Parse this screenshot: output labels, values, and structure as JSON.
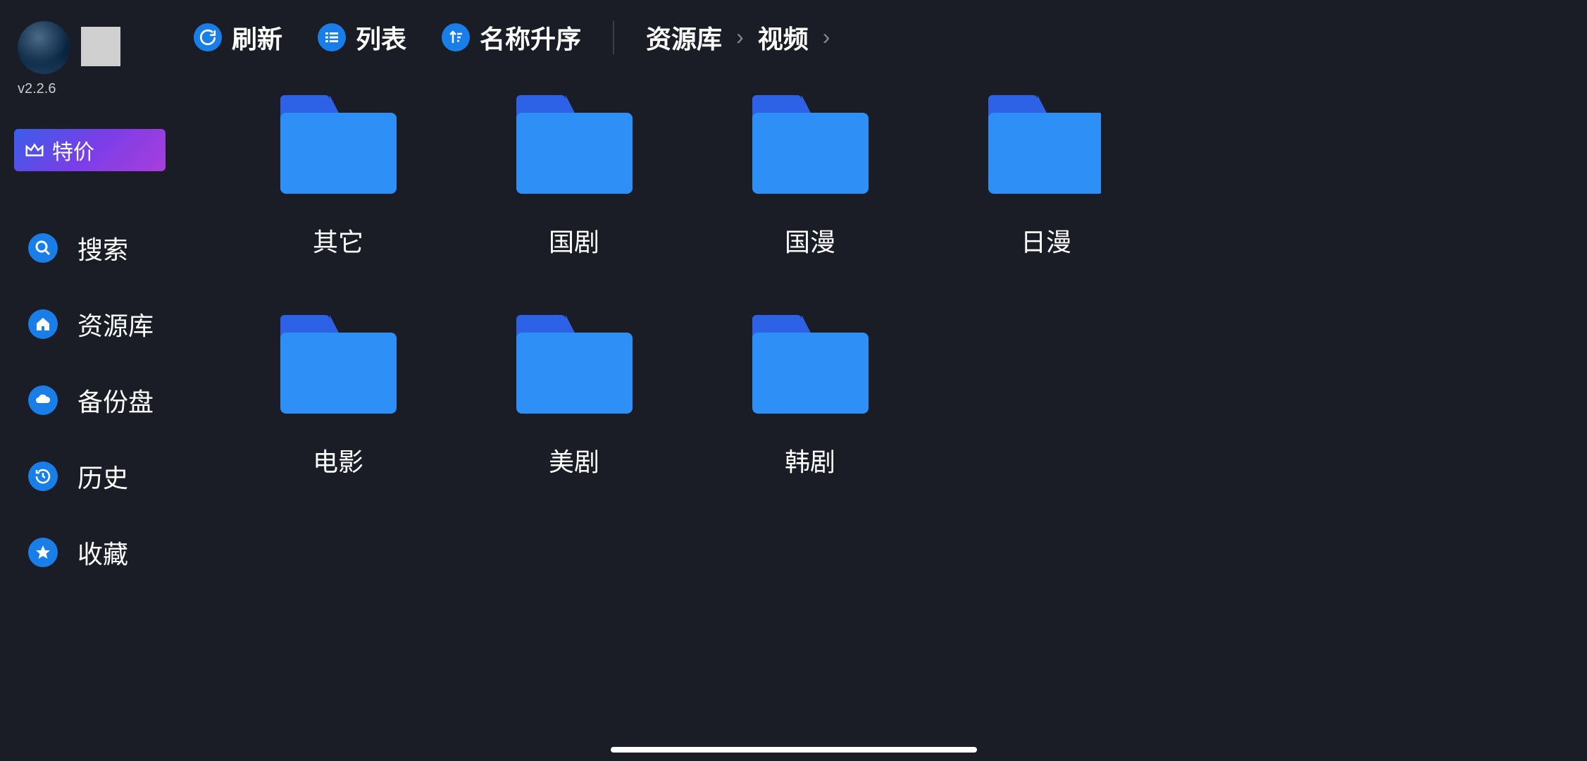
{
  "app": {
    "version": "v2.2.6"
  },
  "promo": {
    "label": "特价"
  },
  "sidebar": {
    "items": [
      {
        "icon": "search",
        "label": "搜索"
      },
      {
        "icon": "home",
        "label": "资源库"
      },
      {
        "icon": "cloud",
        "label": "备份盘"
      },
      {
        "icon": "history",
        "label": "历史"
      },
      {
        "icon": "star",
        "label": "收藏"
      }
    ]
  },
  "toolbar": {
    "refresh_label": "刷新",
    "list_label": "列表",
    "sort_label": "名称升序"
  },
  "breadcrumb": {
    "items": [
      "资源库",
      "视频"
    ]
  },
  "folders": [
    {
      "name": "其它"
    },
    {
      "name": "国剧"
    },
    {
      "name": "国漫"
    },
    {
      "name": "日漫"
    },
    {
      "name": "电影"
    },
    {
      "name": "美剧"
    },
    {
      "name": "韩剧"
    }
  ]
}
